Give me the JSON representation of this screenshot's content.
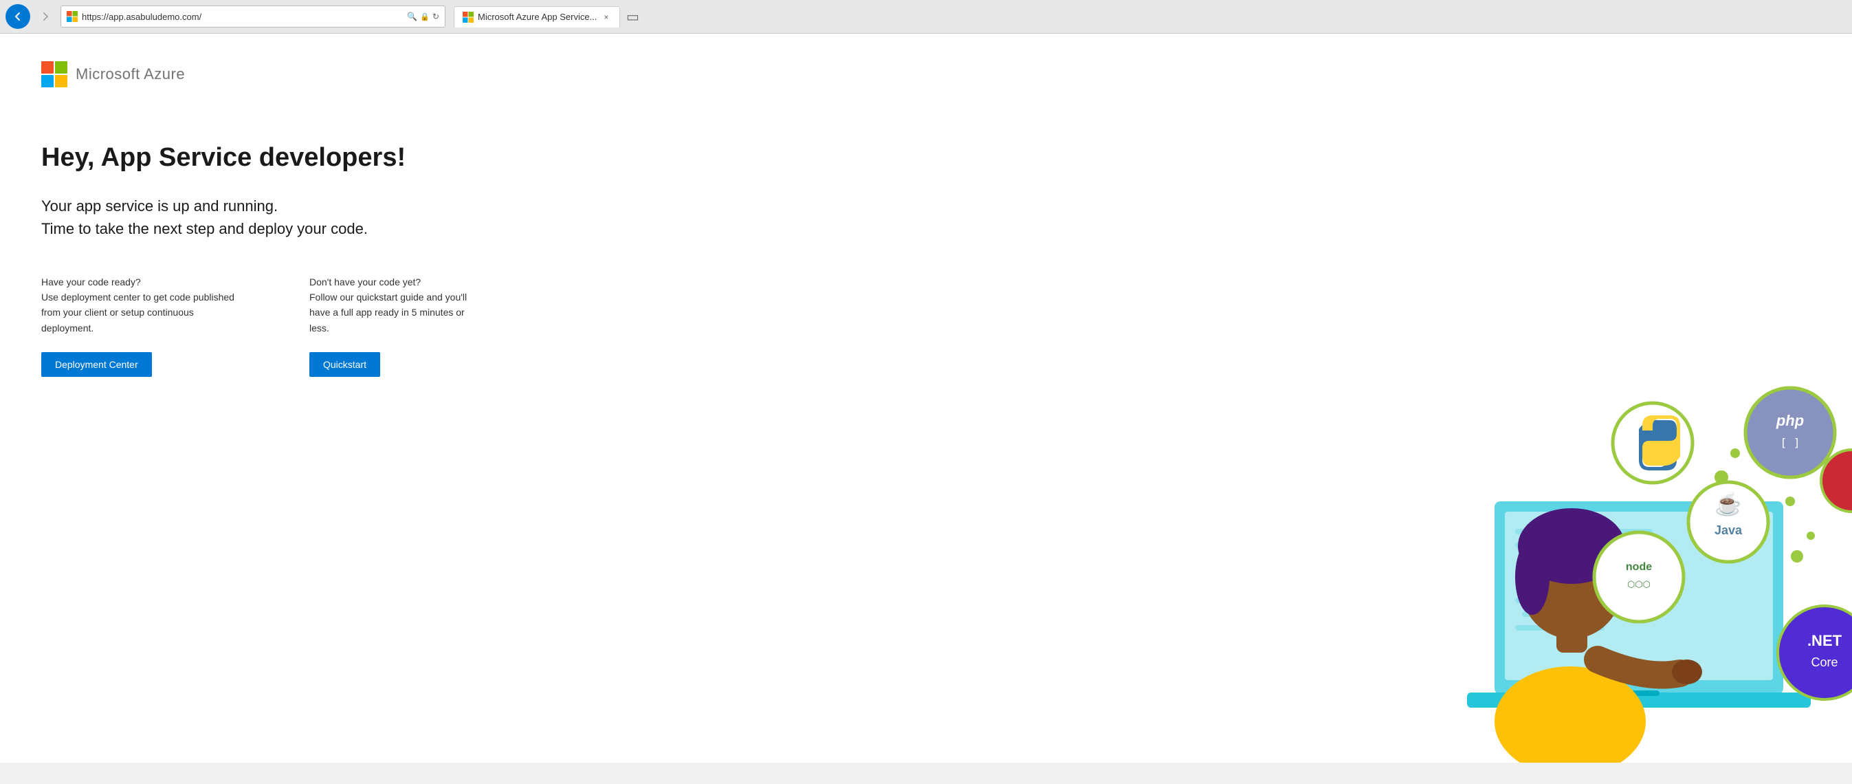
{
  "browser": {
    "back_label": "←",
    "forward_label": "→",
    "url": "https://app.asabuludemo.com/",
    "tab_title": "Microsoft Azure App Service...",
    "tab_close": "×"
  },
  "logo": {
    "text": "Microsoft Azure"
  },
  "page": {
    "title": "Hey, App Service developers!",
    "subtitle_line1": "Your app service is up and running.",
    "subtitle_line2": "Time to take the next step and deploy your code.",
    "cta_left": {
      "description_line1": "Have your code ready?",
      "description_line2": "Use deployment center to get code published",
      "description_line3": "from your client or setup continuous",
      "description_line4": "deployment.",
      "button_label": "Deployment Center"
    },
    "cta_right": {
      "description_line1": "Don't have your code yet?",
      "description_line2": "Follow our quickstart guide and you'll",
      "description_line3": "have a full app ready in 5 minutes or",
      "description_line4": "less.",
      "button_label": "Quickstart"
    }
  },
  "tech_badges": {
    "php": "php",
    "python": "🐍",
    "java": "Java",
    "nodejs": "node",
    "dotnet": ".NET\nCore"
  },
  "colors": {
    "azure_blue": "#0078d4",
    "badge_border": "#9bc940",
    "php_bg": "#8892bf",
    "java_bg": "#f89820",
    "dotnet_bg": "#512bd4",
    "nodejs_bg": "#43853d"
  }
}
